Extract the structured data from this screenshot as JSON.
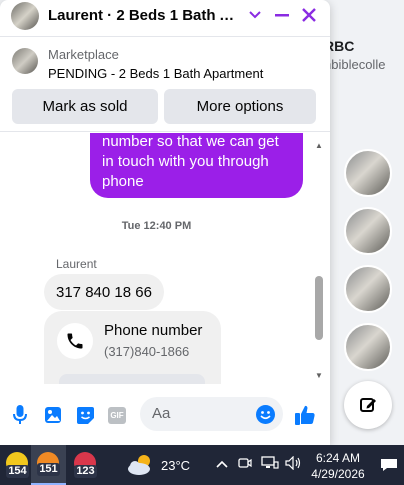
{
  "background": {
    "page_title": "RBC",
    "page_subtitle": "nbiblecolle"
  },
  "chat": {
    "title": "Laurent · 2 Beds 1 Bath Ap...",
    "accent_color": "#9b1fe8",
    "marketplace": {
      "label": "Marketplace",
      "status": "PENDING - 2 Beds 1 Bath Apartment",
      "mark_sold_label": "Mark as sold",
      "more_options_label": "More options"
    },
    "messages": {
      "outgoing_lines": [
        "number so that we can get",
        "in touch with you through",
        "phone"
      ],
      "timestamp": "Tue 12:40 PM",
      "sender": "Laurent",
      "incoming_text": "317 840 18 66",
      "phone_card": {
        "title": "Phone number",
        "number": "(317)840-1866"
      }
    },
    "composer": {
      "placeholder": "Aa",
      "gif_label": "GIF"
    }
  },
  "taskbar": {
    "apps": [
      {
        "badge": "154",
        "color": "#f2c81d"
      },
      {
        "badge": "151",
        "color": "#f08a24"
      },
      {
        "badge": "123",
        "color": "#d9374b"
      }
    ],
    "temperature": "23°C",
    "time": "6:24 AM",
    "date": "4/29/2026"
  }
}
